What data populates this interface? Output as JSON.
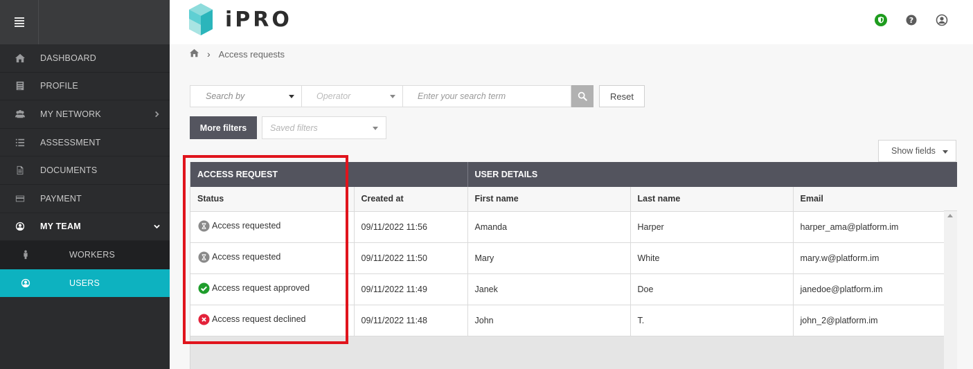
{
  "brand": {
    "name": "iPRO",
    "logo_colors": [
      "#3dc4c9",
      "#7ed9d9",
      "#a9e4e3",
      "#5fcfd3"
    ]
  },
  "sidebar": {
    "items": [
      {
        "label": "DASHBOARD",
        "icon": "home-icon"
      },
      {
        "label": "PROFILE",
        "icon": "profile-icon"
      },
      {
        "label": "MY NETWORK",
        "icon": "network-icon"
      },
      {
        "label": "ASSESSMENT",
        "icon": "list-icon"
      },
      {
        "label": "DOCUMENTS",
        "icon": "document-icon"
      },
      {
        "label": "PAYMENT",
        "icon": "card-icon"
      },
      {
        "label": "MY TEAM",
        "icon": "team-icon"
      }
    ],
    "subitems": [
      {
        "label": "WORKERS",
        "icon": "worker-icon"
      },
      {
        "label": "USERS",
        "icon": "user-icon"
      }
    ],
    "accent": "#0db2c0"
  },
  "breadcrumb": {
    "current": "Access requests"
  },
  "filters": {
    "search_by": "Search by",
    "operator": "Operator",
    "search_term_placeholder": "Enter your search term",
    "reset_label": "Reset",
    "more_filters_label": "More filters",
    "saved_filters": "Saved filters",
    "show_fields_label": "Show fields"
  },
  "table": {
    "groups": {
      "access_request": "ACCESS REQUEST",
      "user_details": "USER DETAILS"
    },
    "columns": [
      "Status",
      "Created at",
      "First name",
      "Last name",
      "Email"
    ],
    "rows": [
      {
        "status": "Access requested",
        "status_type": "pending",
        "created_at": "09/11/2022 11:56",
        "first_name": "Amanda",
        "last_name": "Harper",
        "email": "harper_ama@platform.im"
      },
      {
        "status": "Access requested",
        "status_type": "pending",
        "created_at": "09/11/2022 11:50",
        "first_name": "Mary",
        "last_name": "White",
        "email": "mary.w@platform.im"
      },
      {
        "status": "Access request approved",
        "status_type": "approved",
        "created_at": "09/11/2022 11:49",
        "first_name": "Janek",
        "last_name": "Doe",
        "email": "janedoe@platform.im"
      },
      {
        "status": "Access request declined",
        "status_type": "declined",
        "created_at": "09/11/2022 11:48",
        "first_name": "John",
        "last_name": "T.",
        "email": "john_2@platform.im"
      }
    ]
  },
  "status_colors": {
    "pending": "#8a8a8a",
    "approved": "#1f9d2c",
    "declined": "#e3223a"
  },
  "highlight_color": "#e0141c"
}
